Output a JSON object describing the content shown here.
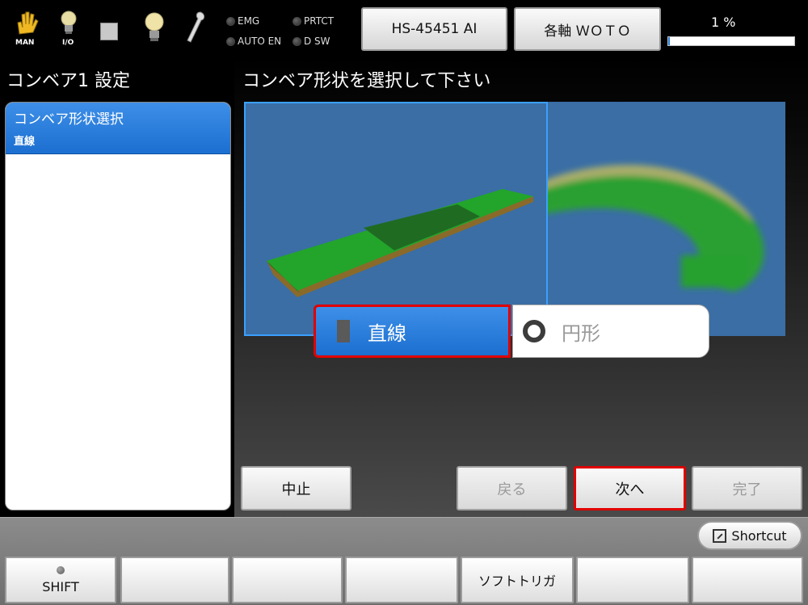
{
  "topbar": {
    "icons": [
      {
        "name": "hand-icon",
        "label": "MAN"
      },
      {
        "name": "bulb-icon",
        "label": "I/O"
      },
      {
        "name": "stop-square-icon",
        "label": ""
      },
      {
        "name": "bulb-icon",
        "label": ""
      },
      {
        "name": "wrench-icon",
        "label": ""
      }
    ],
    "lamps": {
      "emg": "EMG",
      "prtct": "PRTCT",
      "auto_en": "AUTO EN",
      "d_sw": "D SW"
    },
    "robot_button": "HS-45451 AI",
    "axis_button": "各軸 ＷＯＴＯ",
    "progress_text": "1 %",
    "progress_value": 0.01
  },
  "left_panel": {
    "title": "コンベア1 設定",
    "items": [
      {
        "label": "コンベア形状選択",
        "value": "直線"
      }
    ]
  },
  "main": {
    "title": "コンベア形状を選択して下さい",
    "choices": {
      "straight": "直線",
      "circle": "円形"
    },
    "buttons": {
      "abort": "中止",
      "back": "戻る",
      "next": "次へ",
      "finish": "完了"
    }
  },
  "bottom": {
    "shortcut": "Shortcut",
    "fkeys": [
      "SHIFT",
      "",
      "",
      "",
      "ソフトトリガ",
      "",
      ""
    ]
  },
  "colors": {
    "accent": "#1c6fd0",
    "highlight": "#e00000",
    "preview_bg": "#3a6ea5",
    "conveyor_green": "#22a52a"
  }
}
